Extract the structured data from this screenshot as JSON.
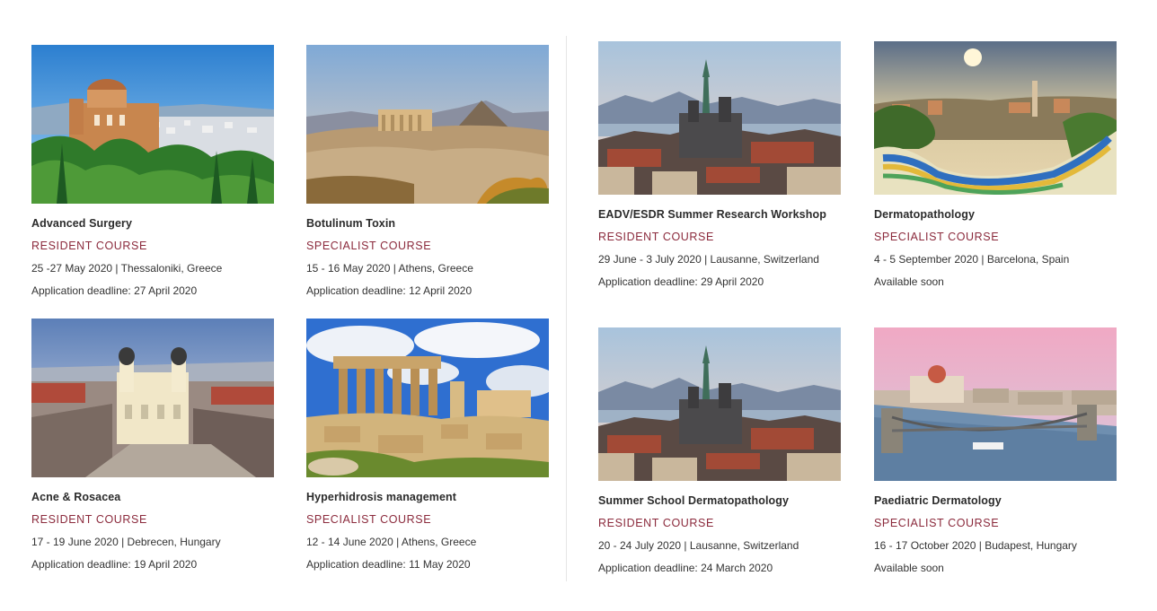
{
  "courses": [
    {
      "title": "Advanced Surgery",
      "type": "RESIDENT COURSE",
      "dates": "25 -27 May 2020 | Thessaloniki, Greece",
      "deadline": "Application deadline: 27 April 2020",
      "image": "thessaloniki-church-photo"
    },
    {
      "title": "Botulinum Toxin",
      "type": "SPECIALIST COURSE",
      "dates": "15 - 16 May 2020 | Athens, Greece",
      "deadline": "Application deadline: 12 April 2020",
      "image": "athens-acropolis-photo"
    },
    {
      "title": "EADV/ESDR Summer Research Workshop",
      "type": "RESIDENT COURSE",
      "dates": "29 June - 3 July 2020 | Lausanne, Switzerland",
      "deadline": "Application deadline: 29 April 2020",
      "image": "lausanne-cathedral-photo"
    },
    {
      "title": "Dermatopathology",
      "type": "SPECIALIST COURSE",
      "dates": "4 - 5 September 2020 | Barcelona, Spain",
      "deadline": "Available soon",
      "image": "barcelona-park-guell-photo"
    },
    {
      "title": "Acne & Rosacea",
      "type": "RESIDENT COURSE",
      "dates": "17 - 19 June 2020 | Debrecen, Hungary",
      "deadline": "Application deadline: 19 April 2020",
      "image": "debrecen-church-photo"
    },
    {
      "title": "Hyperhidrosis management",
      "type": "SPECIALIST COURSE",
      "dates": "12 - 14 June 2020 | Athens, Greece",
      "deadline": "Application deadline: 11 May 2020",
      "image": "parthenon-ruins-photo"
    },
    {
      "title": "Summer School Dermatopathology",
      "type": "RESIDENT COURSE",
      "dates": "20 - 24 July 2020 | Lausanne, Switzerland",
      "deadline": "Application deadline: 24 March 2020",
      "image": "lausanne-cathedral-photo"
    },
    {
      "title": "Paediatric Dermatology",
      "type": "SPECIALIST COURSE",
      "dates": "16 - 17 October 2020 | Budapest, Hungary",
      "deadline": "Available soon",
      "image": "budapest-chain-bridge-photo"
    }
  ],
  "colors": {
    "course_type": "#8b2a3c",
    "title": "#2b2b2b",
    "body_text": "#333333",
    "divider": "#e6e6e6"
  }
}
